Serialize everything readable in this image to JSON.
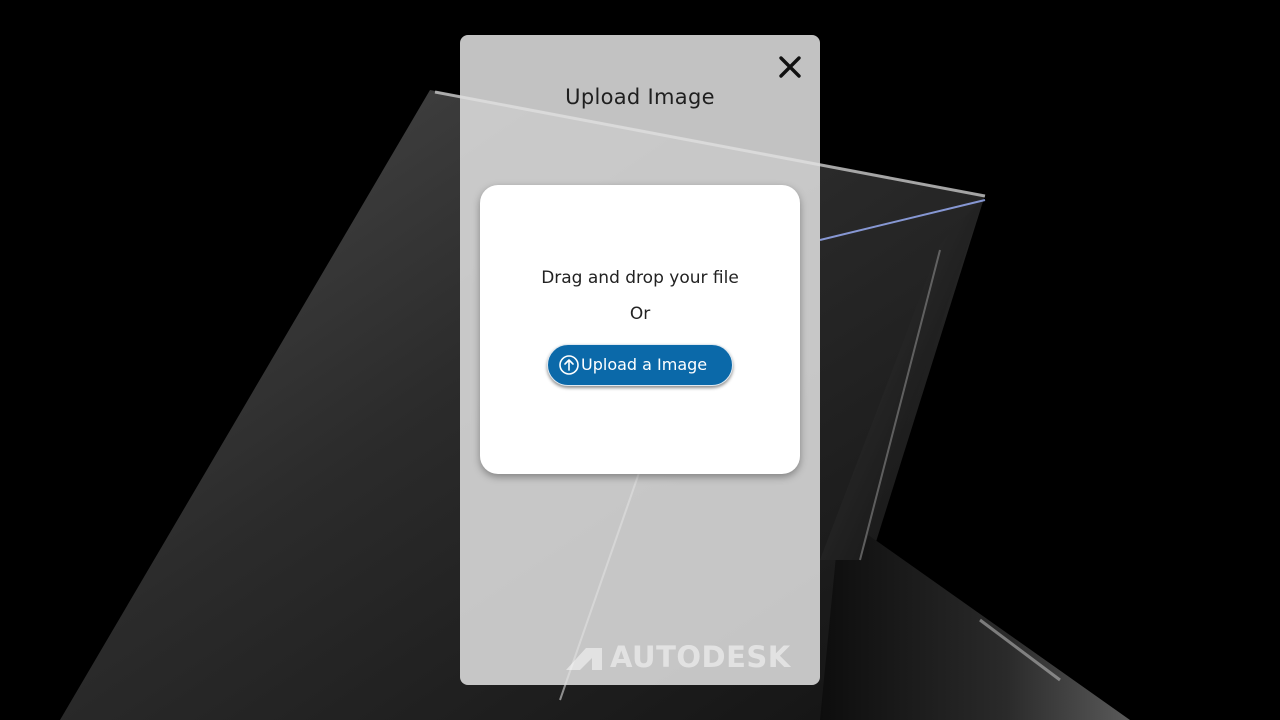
{
  "modal": {
    "title": "Upload Image",
    "close_icon": "close-icon"
  },
  "drop_zone": {
    "instruction": "Drag and drop your file",
    "separator": "Or",
    "upload_button": {
      "label": "Upload a Image",
      "icon": "upload-arrow-circle-icon"
    }
  },
  "brand": {
    "name": "AUTODESK",
    "logo": "autodesk-logo"
  },
  "colors": {
    "page_background": "#000000",
    "modal_background": "#e2e2e2",
    "drop_zone_background": "#ffffff",
    "button_background": "#0b69a9",
    "button_text": "#ffffff"
  }
}
